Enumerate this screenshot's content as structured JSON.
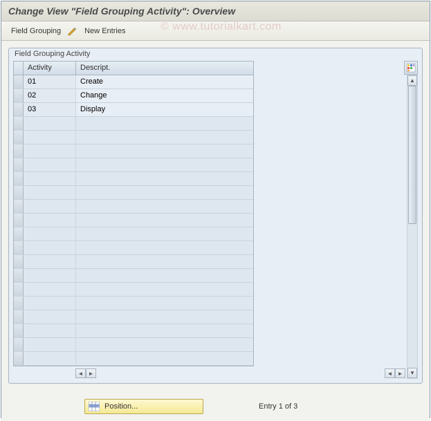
{
  "title": "Change View \"Field Grouping Activity\": Overview",
  "toolbar": {
    "field_grouping_label": "Field Grouping",
    "new_entries_label": "New Entries"
  },
  "watermark": "© www.tutorialkart.com",
  "panel": {
    "title": "Field Grouping Activity",
    "columns": {
      "activity": "Activity",
      "descript": "Descript."
    },
    "rows": [
      {
        "activity": "01",
        "descript": "Create"
      },
      {
        "activity": "02",
        "descript": "Change"
      },
      {
        "activity": "03",
        "descript": "Display"
      }
    ],
    "empty_row_count": 19
  },
  "footer": {
    "position_label": "Position...",
    "entry_text": "Entry 1 of 3"
  },
  "icons": {
    "pencil": "pencil-icon",
    "table_settings": "table-settings-icon"
  }
}
